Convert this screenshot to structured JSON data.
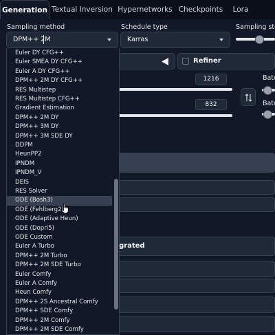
{
  "tabs": [
    {
      "label": "Generation",
      "active": true
    },
    {
      "label": "Textual Inversion"
    },
    {
      "label": "Hypernetworks"
    },
    {
      "label": "Checkpoints"
    },
    {
      "label": "Lora"
    }
  ],
  "sampling_method": {
    "label": "Sampling method",
    "value": "DPM++ 2M"
  },
  "schedule_type": {
    "label": "Schedule type",
    "value": "Karras"
  },
  "sampling_steps": {
    "label": "Sampling steps"
  },
  "refiner": {
    "label": "Refiner",
    "checked": false
  },
  "width_value": "1216",
  "height_value": "832",
  "batch_label_1": "Batch",
  "batch_label_2": "Batch",
  "partial_text": "grated",
  "dropdown_items": [
    "Euler DY CFG++",
    "Euler SMEA DY CFG++",
    "Euler A DY CFG++",
    "DPM++ 2M DY CFG++",
    "RES Multistep",
    "RES Multistep CFG++",
    "Gradient Estimation",
    "DPM++ 2M DY",
    "DPM++ 3M DY",
    "DPM++ 3M SDE DY",
    "DDPM",
    "HeunPP2",
    "IPNDM",
    "IPNDM_V",
    "DEIS",
    "RES Solver",
    "ODE (Bosh3)",
    "ODE (Fehlberg2)",
    "ODE (Adaptive Heun)",
    "ODE (Dopri5)",
    "ODE Custom",
    "Euler A Turbo",
    "DPM++ 2M Turbo",
    "DPM++ 2M SDE Turbo",
    "Euler Comfy",
    "Euler A Comfy",
    "Heun Comfy",
    "DPM++ 2S Ancestral Comfy",
    "DPM++ SDE Comfy",
    "DPM++ 2M Comfy",
    "DPM++ 2M SDE Comfy"
  ],
  "hovered_item": "ODE (Bosh3)",
  "colors": {
    "background": "#0b0f19",
    "panel": "#111827",
    "hover": "#374151"
  }
}
